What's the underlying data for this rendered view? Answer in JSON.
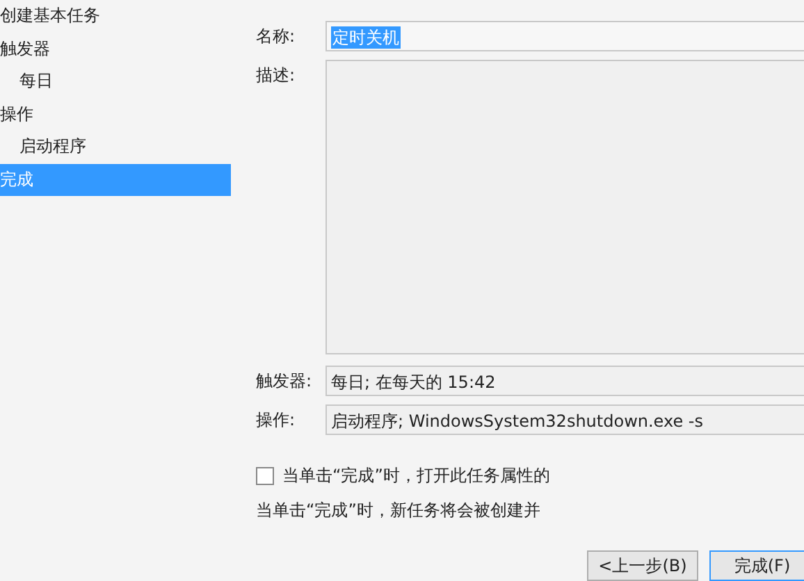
{
  "sidebar": {
    "items": [
      {
        "label": "创建基本任务",
        "selected": false
      },
      {
        "label": "触发器",
        "selected": false,
        "children": [
          {
            "label": "每日",
            "selected": false
          }
        ]
      },
      {
        "label": "操作",
        "selected": false,
        "children": [
          {
            "label": "启动程序",
            "selected": false
          }
        ]
      },
      {
        "label": "完成",
        "selected": true
      }
    ]
  },
  "form": {
    "name_label": "名称:",
    "name_value": "定时关机",
    "name_selected": true,
    "description_label": "描述:",
    "trigger_label": "触发器:",
    "trigger_value": "每日; 在每天的 15:42",
    "action_label": "操作:",
    "action_value": "启动程序; WindowsSystem32shutdown.exe -s"
  },
  "open_properties": {
    "label": "当单击“完成”时，打开此任务属性的",
    "checked": false
  },
  "note": "当单击“完成”时，新任务将会被创建并",
  "buttons": [
    "<上一步(B)",
    "完成(F)"
  ]
}
